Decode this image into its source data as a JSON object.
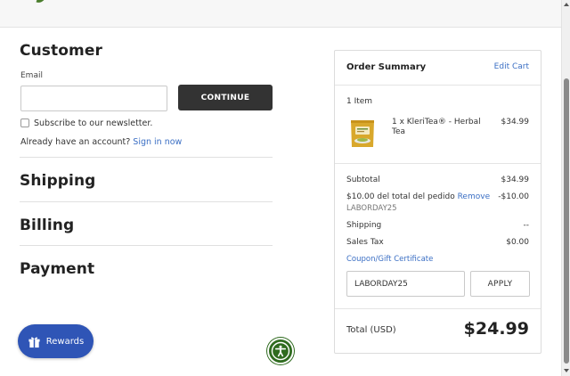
{
  "customer": {
    "heading": "Customer",
    "email_label": "Email",
    "email_value": "",
    "continue_label": "CONTINUE",
    "newsletter_label": "Subscribe to our newsletter.",
    "signin_prompt": "Already have an account?",
    "signin_link": "Sign in now"
  },
  "sections": {
    "shipping": "Shipping",
    "billing": "Billing",
    "payment": "Payment"
  },
  "rewards": {
    "label": "Rewards",
    "icon": "gift-icon"
  },
  "accessibility": {
    "icon": "accessibility-icon",
    "color": "#2f6b1f"
  },
  "summary": {
    "title": "Order Summary",
    "edit_cart": "Edit Cart",
    "items_count": "1 Item",
    "product": {
      "name": "1 x KleriTea® - Herbal Tea",
      "price": "$34.99"
    },
    "subtotal_label": "Subtotal",
    "subtotal_value": "$34.99",
    "discount_label": "$10.00 del total del pedido",
    "discount_remove": "Remove",
    "discount_value": "-$10.00",
    "discount_code": "LABORDAY25",
    "shipping_label": "Shipping",
    "shipping_value": "--",
    "tax_label": "Sales Tax",
    "tax_value": "$0.00",
    "coupon_link": "Coupon/Gift Certificate",
    "coupon_value": "LABORDAY25",
    "apply_label": "APPLY",
    "total_label": "Total (USD)",
    "total_value": "$24.99"
  },
  "colors": {
    "link": "#3b6fc4",
    "dark_button": "#333333",
    "rewards": "#2f55b6",
    "accent_green": "#4a7d2c"
  }
}
